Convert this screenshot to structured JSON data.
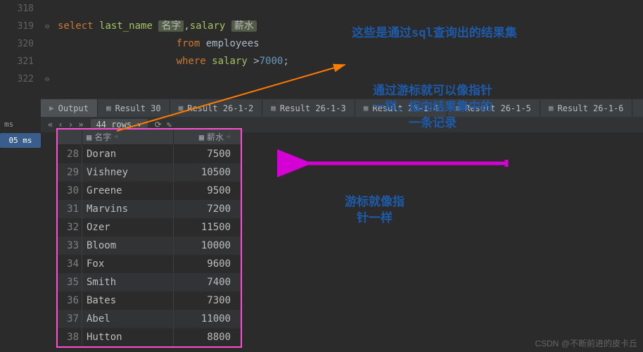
{
  "editor": {
    "line_numbers": [
      "318",
      "319",
      "320",
      "321",
      "322"
    ],
    "fold_marks": [
      "",
      "⊖",
      "",
      "",
      "⊖"
    ],
    "code": {
      "l1": {
        "select": "select",
        "last_name": "last_name",
        "alias1": "名字",
        "comma": ",",
        "salary": "salary",
        "alias2": "薪水"
      },
      "l2": {
        "from": "from",
        "tbl": "employees"
      },
      "l3": {
        "where": "where",
        "sal": "salary",
        "gt": ">",
        "num": "7000",
        "semi": ";"
      }
    }
  },
  "tabs": [
    {
      "label": "Output",
      "active": true
    },
    {
      "label": "Result 30"
    },
    {
      "label": "Result 26-1-2"
    },
    {
      "label": "Result 26-1-3"
    },
    {
      "label": "Result 26-1-4"
    },
    {
      "label": "Result 26-1-5"
    },
    {
      "label": "Result 26-1-6"
    }
  ],
  "toolbar": {
    "rows": "44 rows ▾",
    "arrows": "« ‹ › »",
    "controls": "⟳  ✎"
  },
  "leftstrip": {
    "ms": "ms",
    "time": "05 ms"
  },
  "result": {
    "headers": {
      "name": "名字",
      "salary": "薪水"
    },
    "rows": [
      {
        "i": "28",
        "name": "Doran",
        "sal": "7500"
      },
      {
        "i": "29",
        "name": "Vishney",
        "sal": "10500"
      },
      {
        "i": "30",
        "name": "Greene",
        "sal": "9500"
      },
      {
        "i": "31",
        "name": "Marvins",
        "sal": "7200"
      },
      {
        "i": "32",
        "name": "Ozer",
        "sal": "11500"
      },
      {
        "i": "33",
        "name": "Bloom",
        "sal": "10000"
      },
      {
        "i": "34",
        "name": "Fox",
        "sal": "9600"
      },
      {
        "i": "35",
        "name": "Smith",
        "sal": "7400"
      },
      {
        "i": "36",
        "name": "Bates",
        "sal": "7300"
      },
      {
        "i": "37",
        "name": "Abel",
        "sal": "11000"
      },
      {
        "i": "38",
        "name": "Hutton",
        "sal": "8800"
      }
    ]
  },
  "annotations": {
    "a1": "这些是通过sql查询出的结果集",
    "a2": "通过游标就可以像指针\n一样，指向结果集中的\n一条记录",
    "a3": "游标就像指\n针一样"
  },
  "watermark": "CSDN @不断前进的皮卡丘"
}
